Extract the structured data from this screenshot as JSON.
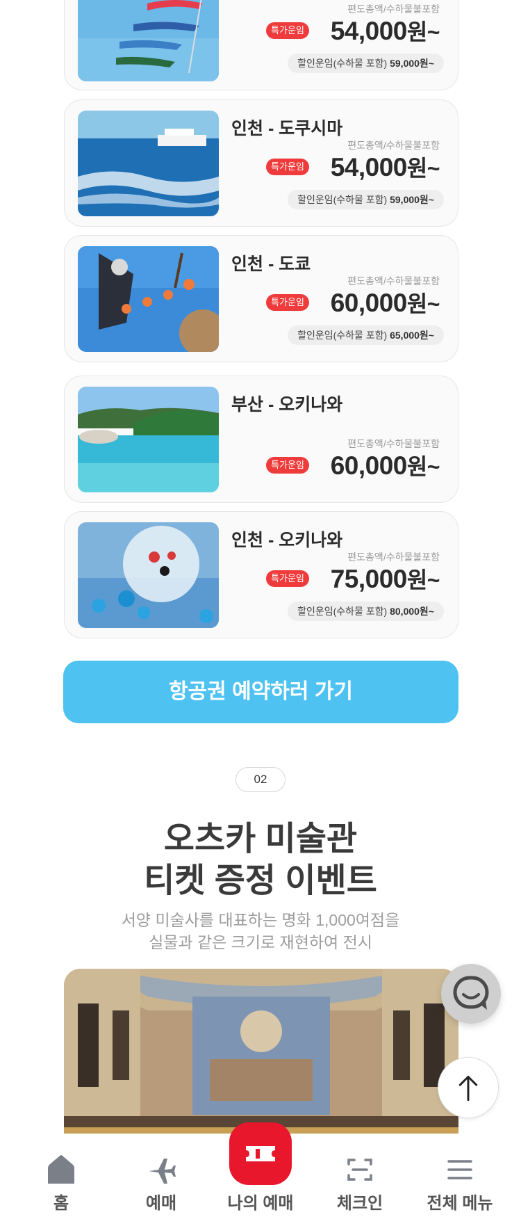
{
  "fare_note": "편도총액/수하물불포함",
  "badge_label": "특가운임",
  "routes": [
    {
      "name": "",
      "price": "54,000",
      "unit": "원~",
      "discount_label": "할인운임(수하물 포함)",
      "discount_price": "59,000원~"
    },
    {
      "name": "인천 - 도쿠시마",
      "price": "54,000",
      "unit": "원~",
      "discount_label": "할인운임(수하물 포함)",
      "discount_price": "59,000원~"
    },
    {
      "name": "인천 - 도쿄",
      "price": "60,000",
      "unit": "원~",
      "discount_label": "할인운임(수하물 포함)",
      "discount_price": "65,000원~"
    },
    {
      "name": "부산 - 오키나와",
      "price": "60,000",
      "unit": "원~"
    },
    {
      "name": "인천 - 오키나와",
      "price": "75,000",
      "unit": "원~",
      "discount_label": "할인운임(수하물 포함)",
      "discount_price": "80,000원~"
    }
  ],
  "cta_label": "항공권 예약하러 가기",
  "event": {
    "step": "02",
    "title_line1": "오츠카 미술관",
    "title_line2": "티켓 증정 이벤트",
    "sub_line1": "서양 미술사를 대표하는 명화 1,000여점을",
    "sub_line2": "실물과 같은 크기로 재현하여 전시"
  },
  "tabbar": {
    "home": "홈",
    "booking": "예매",
    "my_booking": "나의 예매",
    "checkin": "체크인",
    "menu": "전체 메뉴"
  },
  "colors": {
    "accent_red": "#e8172c",
    "badge_red": "#ef3b3b",
    "cta_blue": "#4ec2f1"
  }
}
